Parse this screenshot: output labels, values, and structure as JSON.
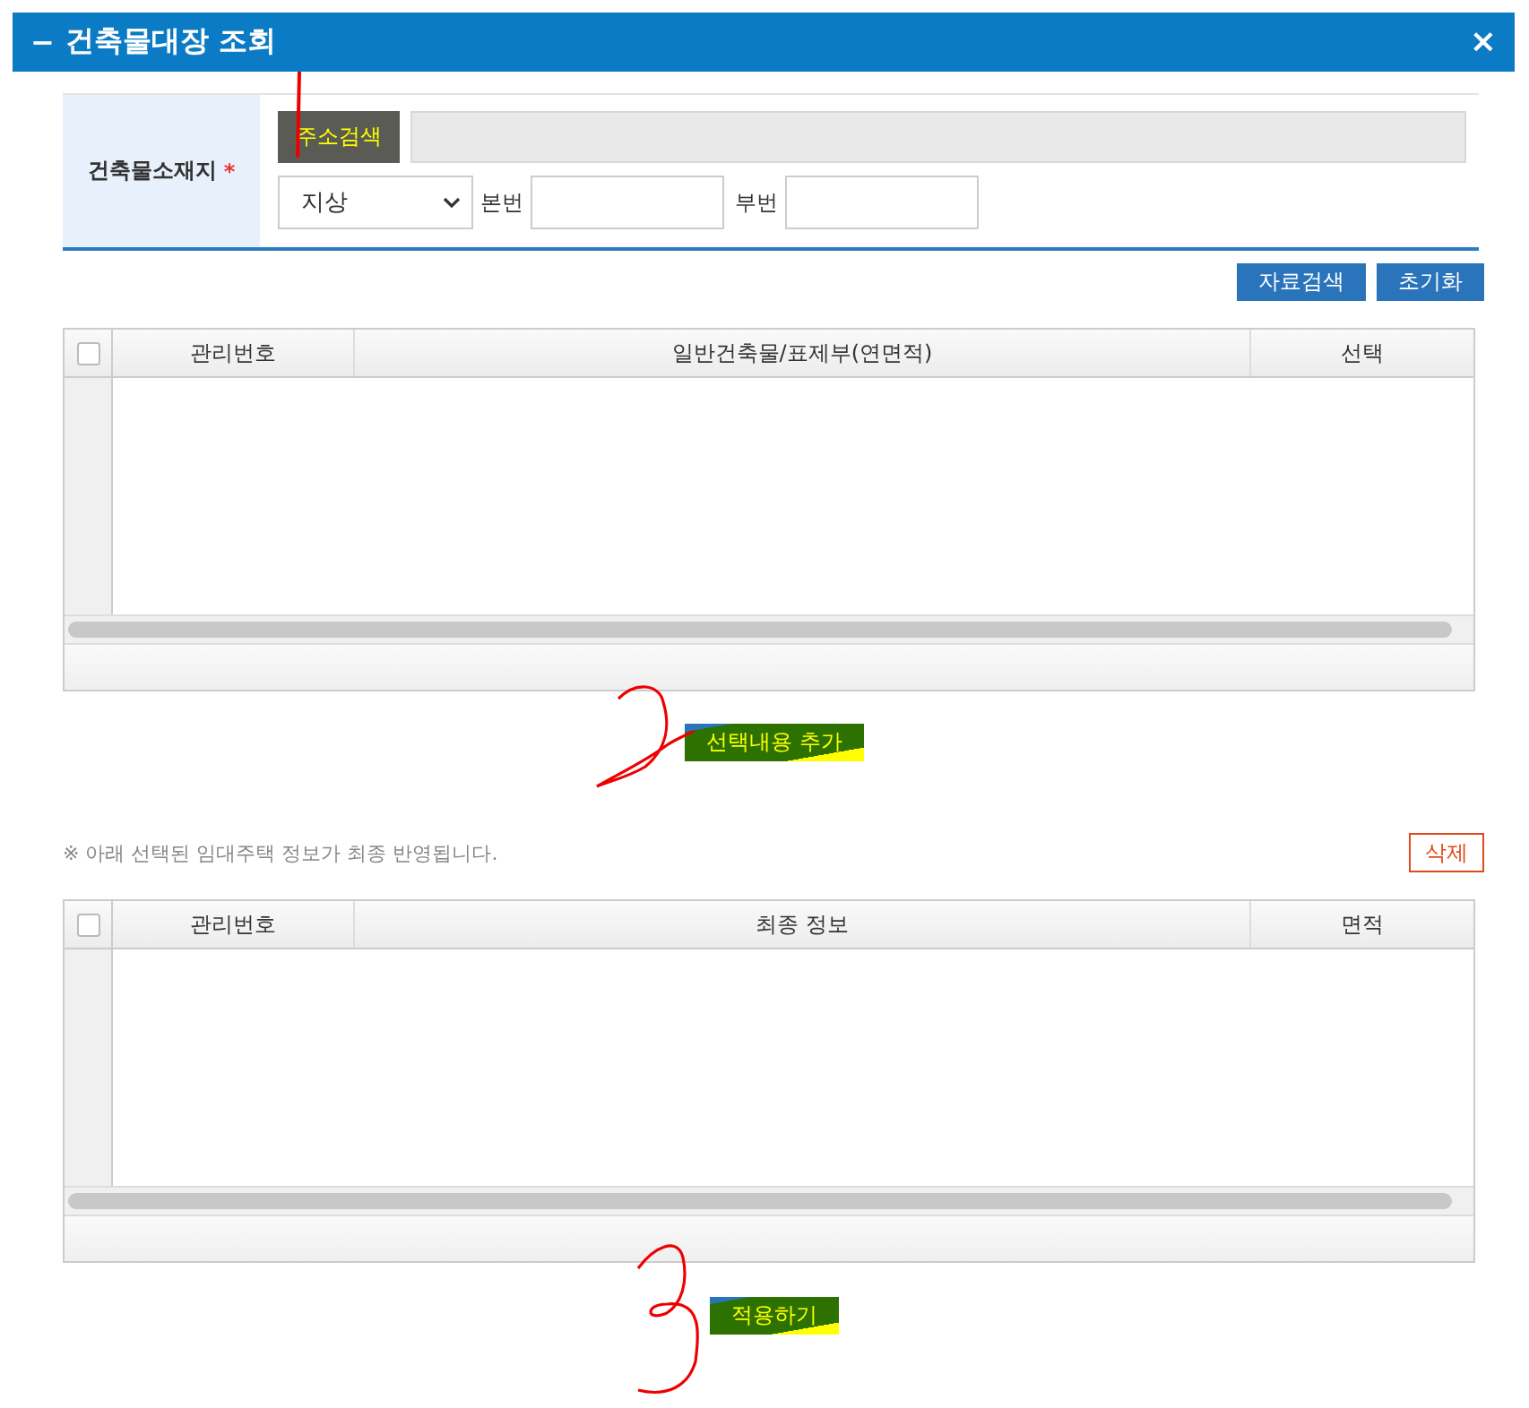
{
  "window": {
    "title": "건축물대장 조회",
    "collapse_glyph": "−",
    "close_glyph": "×"
  },
  "form": {
    "label": "건축물소재지",
    "required_mark": "*",
    "address_button": "주소검색",
    "land_type": "지상",
    "main_number_label": "본번",
    "sub_number_label": "부번"
  },
  "search_buttons": [
    "자료검색",
    "초기화"
  ],
  "results_grid": {
    "columns": [
      "관리번호",
      "일반건축물/표제부(연면적)",
      "선택"
    ],
    "all_checked": false
  },
  "add_button": "선택내용 추가",
  "note": "※ 아래 선택된 임대주택 정보가 최종 반영됩니다.",
  "delete_button": "삭제",
  "final_grid": {
    "columns": [
      "관리번호",
      "최종 정보",
      "면적"
    ],
    "all_checked": false
  },
  "apply_button": "적용하기"
}
